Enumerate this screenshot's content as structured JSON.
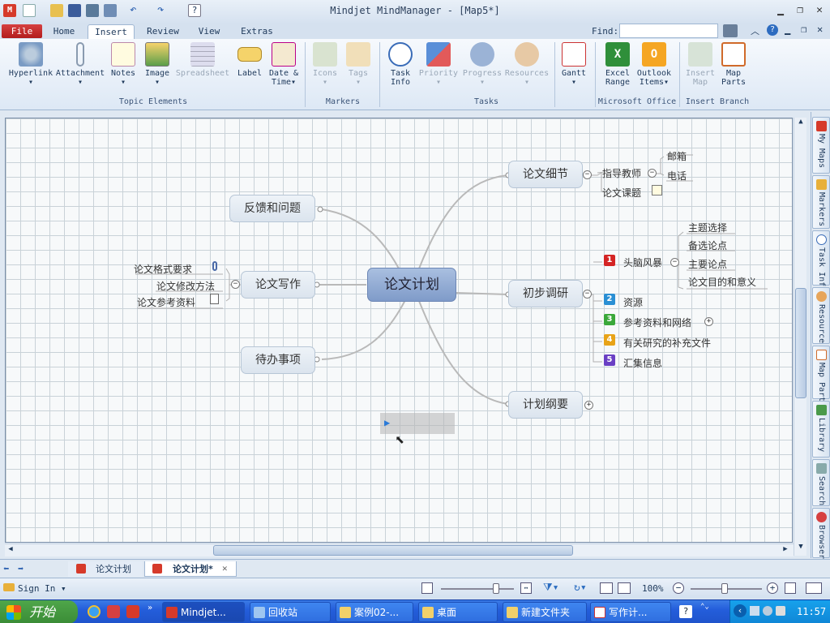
{
  "app": {
    "title": "Mindjet MindManager - [Map5*]",
    "find_label": "Find:",
    "find_value": ""
  },
  "tabs": {
    "file": "File",
    "items": [
      "Home",
      "Insert",
      "Review",
      "View",
      "Extras"
    ],
    "active": "Insert"
  },
  "ribbon": {
    "topic_elements": {
      "label": "Topic Elements",
      "buttons": [
        "Hyperlink",
        "Attachment",
        "Notes",
        "Image",
        "Spreadsheet",
        "Label",
        "Date &",
        "Time"
      ]
    },
    "markers": {
      "label": "Markers",
      "buttons": [
        "Icons",
        "Tags"
      ]
    },
    "tasks": {
      "label": "Tasks",
      "buttons": [
        "Task",
        "Info",
        "Priority",
        "Progress",
        "Resources",
        "Gantt"
      ]
    },
    "office": {
      "label": "Microsoft Office",
      "buttons": [
        "Excel",
        "Range",
        "Outlook",
        "Items"
      ]
    },
    "branch": {
      "label": "Insert Branch",
      "buttons": [
        "Insert",
        "Map",
        "Map",
        "Parts"
      ]
    }
  },
  "map": {
    "central": "论文计划",
    "left_topics": [
      "反馈和问题",
      "论文写作",
      "待办事项"
    ],
    "writing_subs": [
      "论文格式要求",
      "论文修改方法",
      "论文参考资料"
    ],
    "right_topics": [
      "论文细节",
      "初步调研",
      "计划纲要"
    ],
    "details_subs": [
      "指导教师",
      "论文课题"
    ],
    "teacher_subs": [
      "邮箱",
      "电话"
    ],
    "research_subs": [
      {
        "num": "1",
        "label": "头脑风暴",
        "color": "#d42424"
      },
      {
        "num": "2",
        "label": "资源",
        "color": "#2a8fd4"
      },
      {
        "num": "3",
        "label": "参考资料和网络",
        "color": "#3aa83a"
      },
      {
        "num": "4",
        "label": "有关研究的补充文件",
        "color": "#e8a317"
      },
      {
        "num": "5",
        "label": "汇集信息",
        "color": "#6a3fc4"
      }
    ],
    "brainstorm_subs": [
      "主题选择",
      "备选论点",
      "主要论点",
      "论文目的和意义"
    ]
  },
  "right_panel": [
    "My Maps",
    "Markers",
    "Task Inf",
    "Resource",
    "Map Part",
    "Library",
    "Search",
    "Browser"
  ],
  "doc_tabs": [
    "论文计划",
    "论文计划*"
  ],
  "status": {
    "sign_in": "Sign In",
    "zoom": "100%"
  },
  "taskbar": {
    "start": "开始",
    "buttons": [
      "Mindjet...",
      "回收站",
      "案例02-...",
      "桌面",
      "新建文件夹",
      "写作计..."
    ],
    "clock": "11:57"
  }
}
